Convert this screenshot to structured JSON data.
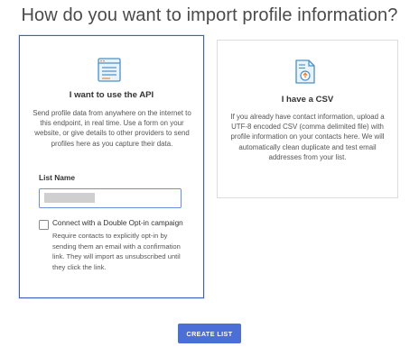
{
  "page": {
    "title": "How do you want to import profile information?"
  },
  "colors": {
    "accent": "#4b6fd6",
    "selected_border": "#3f5ec4",
    "icon_blue": "#4a90c8",
    "icon_orange": "#e8863a"
  },
  "api_card": {
    "icon": "api-window-icon",
    "title": "I want to use the API",
    "description": "Send profile data from anywhere on the internet to this endpoint, in real time. Use a form on your website, or give details to other providers to send profiles here as you capture their data.",
    "list_name_label": "List Name",
    "list_name_value": "",
    "double_optin_label": "Connect with a Double Opt-in campaign",
    "double_optin_checked": false,
    "double_optin_desc": "Require contacts to explicitly opt-in by sending them an email with a confirmation link. They will import as unsubscribed until they click the link."
  },
  "csv_card": {
    "icon": "csv-upload-icon",
    "title": "I have a CSV",
    "description": "If you already have contact information, upload a UTF-8 encoded CSV (comma delimited file) with profile information on your contacts here. We will automatically clean duplicate and test email addresses from your list."
  },
  "actions": {
    "create_list_label": "CREATE LIST"
  }
}
